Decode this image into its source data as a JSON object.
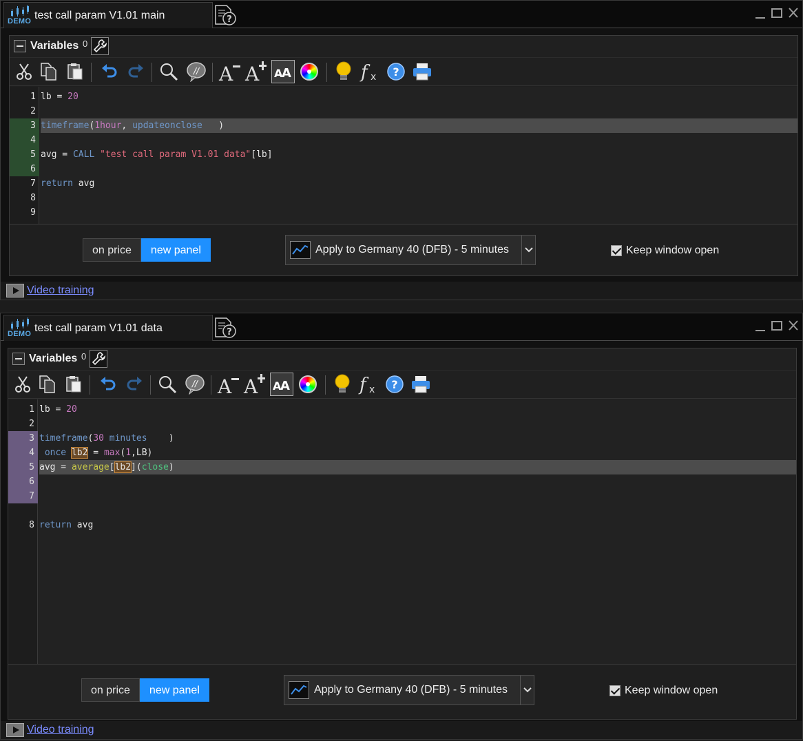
{
  "logo_text": "DEMO",
  "windows": [
    {
      "title": "test call param V1.01 main",
      "variables_label": "Variables",
      "variables_count": "0",
      "lines": [
        {
          "n": "1",
          "tokens": [
            [
              "",
              "lb = "
            ],
            [
              "num",
              "20"
            ]
          ]
        },
        {
          "n": "2",
          "tokens": []
        },
        {
          "n": "3",
          "tokens": [
            [
              "kw",
              "timeframe"
            ],
            [
              "",
              "("
            ],
            [
              "num",
              "1hour"
            ],
            [
              "",
              ", "
            ],
            [
              "kw",
              "updateonclose"
            ],
            [
              "",
              "   )"
            ]
          ]
        },
        {
          "n": "4",
          "tokens": []
        },
        {
          "n": "5",
          "tokens": [
            [
              "",
              "avg = "
            ],
            [
              "kw",
              "CALL"
            ],
            [
              "",
              " "
            ],
            [
              "str",
              "\"test call param V1.01 data\""
            ],
            [
              "",
              "[lb]"
            ]
          ]
        },
        {
          "n": "6",
          "tokens": []
        },
        {
          "n": "7",
          "tokens": [
            [
              "kw",
              "return"
            ],
            [
              "",
              " avg"
            ]
          ]
        },
        {
          "n": "8",
          "tokens": []
        },
        {
          "n": "9",
          "tokens": []
        }
      ],
      "on_price": "on price",
      "new_panel": "new panel",
      "apply": "Apply to Germany 40 (DFB) - 5 minutes",
      "keep_open": "Keep window open",
      "video": "Video training"
    },
    {
      "title": "test call param V1.01 data",
      "variables_label": "Variables",
      "variables_count": "0",
      "lines": [
        {
          "n": "1",
          "tokens": [
            [
              "",
              "lb = "
            ],
            [
              "num",
              "20"
            ]
          ]
        },
        {
          "n": "2",
          "tokens": []
        },
        {
          "n": "3",
          "tokens": [
            [
              "kw",
              "timeframe"
            ],
            [
              "",
              "("
            ],
            [
              "num",
              "30"
            ],
            [
              "",
              " "
            ],
            [
              "kw",
              "minutes"
            ],
            [
              "",
              "    )"
            ]
          ]
        },
        {
          "n": "4",
          "tokens": [
            [
              "",
              " "
            ],
            [
              "kw",
              "once"
            ],
            [
              "",
              " "
            ],
            [
              "box",
              "lb2"
            ],
            [
              "",
              " = "
            ],
            [
              "num",
              "max"
            ],
            [
              "",
              "("
            ],
            [
              "num",
              "1"
            ],
            [
              "",
              ",LB)"
            ]
          ]
        },
        {
          "n": "5",
          "tokens": [
            [
              "",
              "avg = "
            ],
            [
              "fn",
              "average"
            ],
            [
              "",
              "["
            ],
            [
              "box",
              "lb2"
            ],
            [
              "",
              "]("
            ],
            [
              "cl",
              "close"
            ],
            [
              "",
              ")"
            ]
          ]
        },
        {
          "n": "6",
          "tokens": []
        },
        {
          "n": "7",
          "tokens": []
        },
        {
          "n": "8",
          "tokens": [
            [
              "kw",
              "return"
            ],
            [
              "",
              " avg"
            ]
          ]
        }
      ],
      "on_price": "on price",
      "new_panel": "new panel",
      "apply": "Apply to Germany 40 (DFB) - 5 minutes",
      "keep_open": "Keep window open",
      "video": "Video training"
    }
  ],
  "toolbar_icons": [
    "cut-icon",
    "copy-icon",
    "paste-icon",
    "undo-icon",
    "redo-icon",
    "search-icon",
    "comment-icon",
    "decrease-font-icon",
    "increase-font-icon",
    "font-style-icon",
    "color-wheel-icon",
    "lightbulb-icon",
    "function-icon",
    "help-icon",
    "print-icon"
  ],
  "colors": {
    "accent": "#1e90ff",
    "keyword": "#6f97c9",
    "number": "#c77ac0",
    "string": "#e06a7c",
    "function": "#c8c848",
    "constant": "#4fc37f",
    "link": "#7b8cff"
  }
}
